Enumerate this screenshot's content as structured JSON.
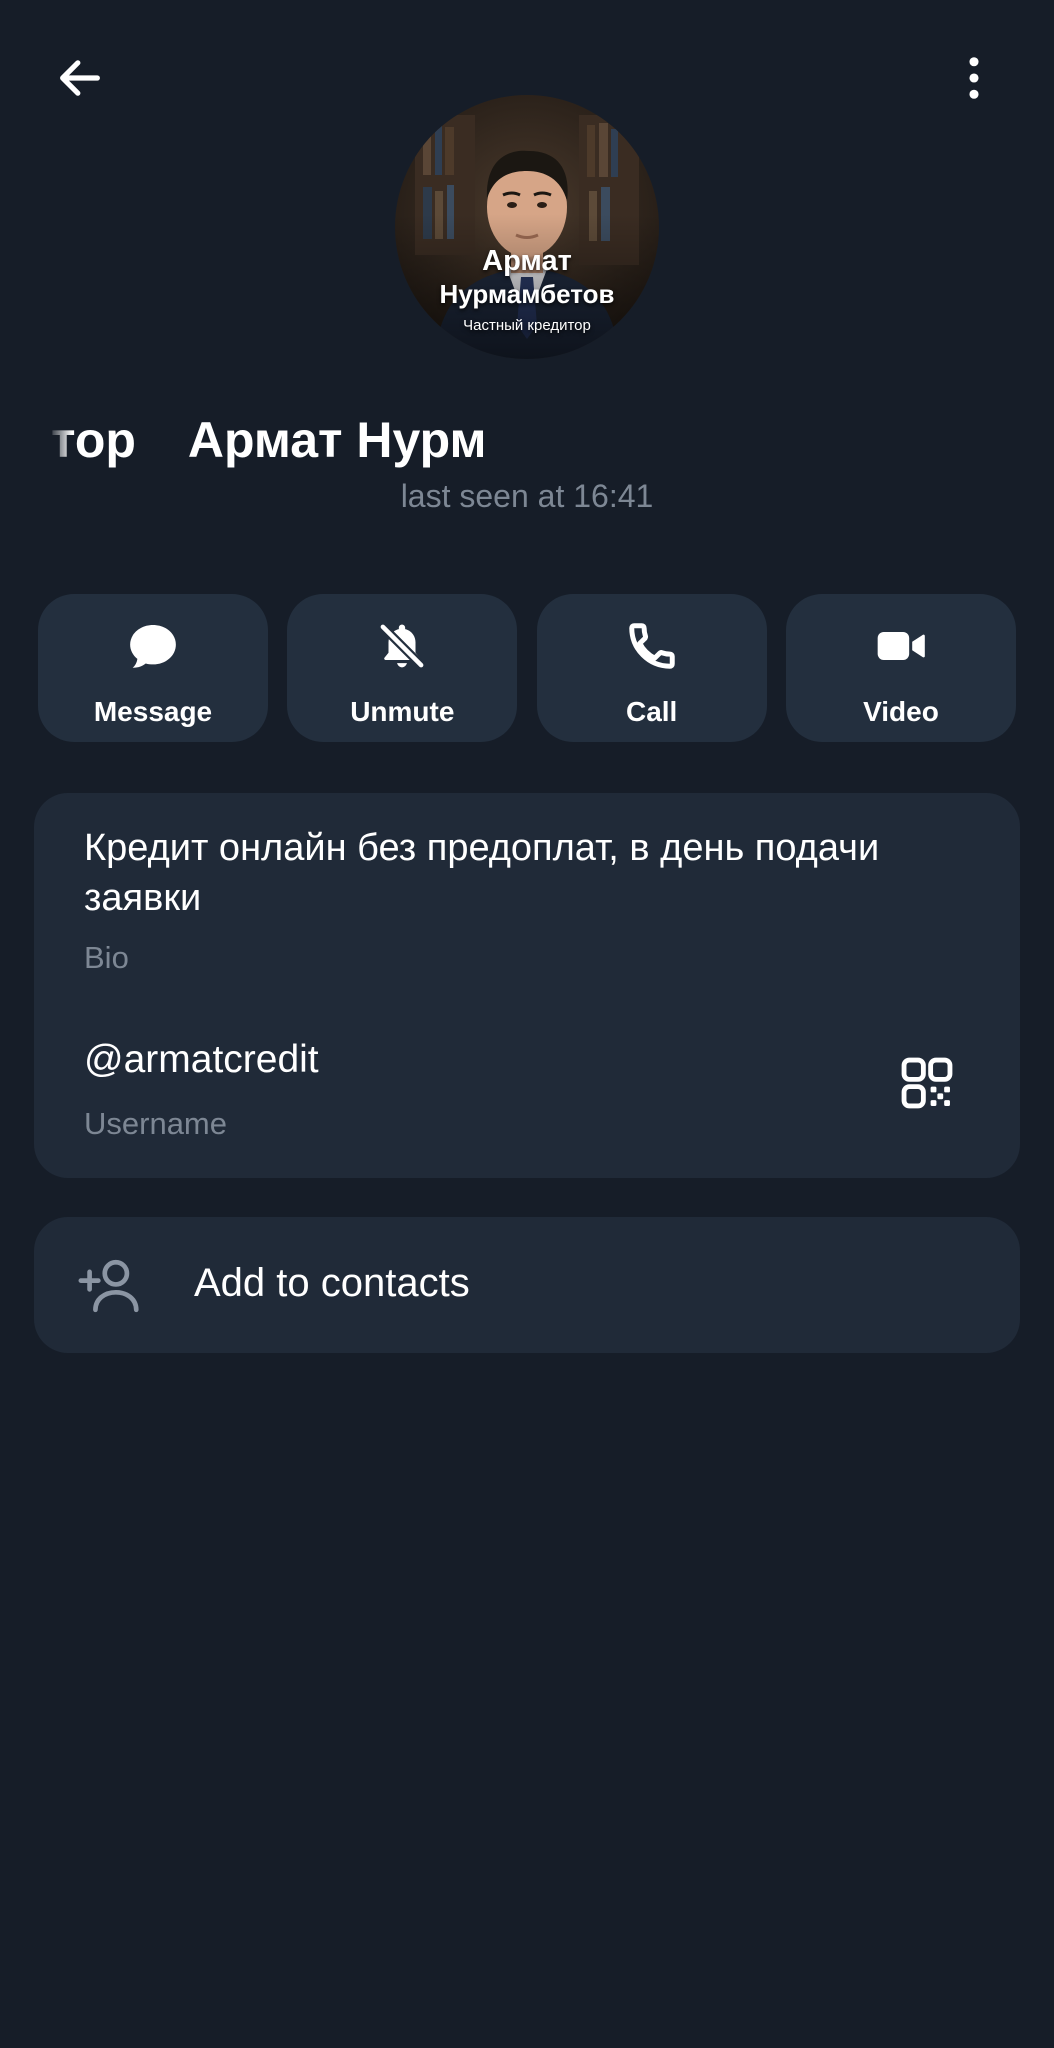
{
  "header": {
    "back_icon": "arrow-left-icon",
    "more_icon": "more-vertical-icon"
  },
  "profile": {
    "avatar_text": {
      "line1": "Армат",
      "line2": "Нурмамбетов",
      "line3": "Частный кредитор"
    },
    "display_name_visible": "тов | Частный Кредитор",
    "display_name_loop": "Армат Нурм",
    "status": "last seen at 16:41"
  },
  "actions": [
    {
      "label": "Message",
      "icon": "message-bubble-icon"
    },
    {
      "label": "Unmute",
      "icon": "bell-off-icon"
    },
    {
      "label": "Call",
      "icon": "phone-icon"
    },
    {
      "label": "Video",
      "icon": "video-camera-icon"
    }
  ],
  "info": {
    "bio": "Кредит онлайн без предоплат, в день подачи заявки",
    "bio_label": "Bio",
    "username": "@armatcredit",
    "username_label": "Username",
    "qr_icon": "qr-code-icon"
  },
  "contacts": {
    "label": "Add to contacts",
    "icon": "add-user-icon"
  },
  "colors": {
    "background": "#161d28",
    "card": "#202a38",
    "button": "#232f3e",
    "secondary_text": "#7d8794"
  }
}
